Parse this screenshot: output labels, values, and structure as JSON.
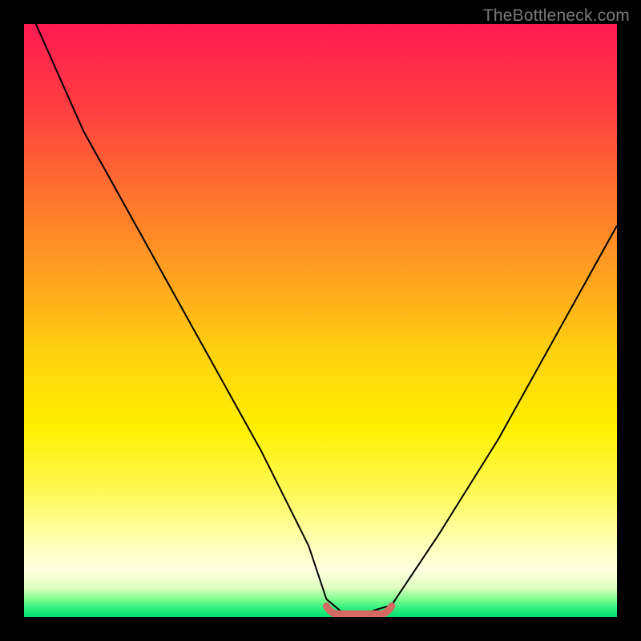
{
  "watermark": "TheBottleneck.com",
  "colors": {
    "frame": "#000000",
    "curve": "#000000",
    "valley_marker": "#d46a63",
    "gradient_stops": [
      {
        "pos": 0.0,
        "hex": "#ff1a52"
      },
      {
        "pos": 0.15,
        "hex": "#ff4040"
      },
      {
        "pos": 0.28,
        "hex": "#ff7030"
      },
      {
        "pos": 0.42,
        "hex": "#ffa020"
      },
      {
        "pos": 0.55,
        "hex": "#ffd010"
      },
      {
        "pos": 0.68,
        "hex": "#fff000"
      },
      {
        "pos": 0.8,
        "hex": "#fffa60"
      },
      {
        "pos": 0.87,
        "hex": "#ffffb0"
      },
      {
        "pos": 0.92,
        "hex": "#ffffe0"
      },
      {
        "pos": 0.95,
        "hex": "#e0ffc0"
      },
      {
        "pos": 0.97,
        "hex": "#80ff90"
      },
      {
        "pos": 0.985,
        "hex": "#30f080"
      },
      {
        "pos": 1.0,
        "hex": "#00e070"
      }
    ]
  },
  "chart_data": {
    "type": "line",
    "title": "",
    "xlabel": "",
    "ylabel": "",
    "xlim": [
      0,
      100
    ],
    "ylim": [
      0,
      100
    ],
    "note": "x/y are approximate percentages of the plot area; y=0 is the bottom (green), y=100 is the top (red). The curve is a V shape with a flat valley region highlighted in salmon.",
    "series": [
      {
        "name": "bottleneck-curve",
        "x": [
          2,
          10,
          20,
          30,
          40,
          48,
          51,
          54,
          57,
          62,
          70,
          80,
          90,
          100
        ],
        "y": [
          100,
          82,
          64,
          46,
          28,
          12,
          3,
          0.5,
          0.5,
          2,
          14,
          30,
          48,
          66
        ]
      }
    ],
    "valley_marker": {
      "name": "optimal-range",
      "x_range": [
        51,
        62
      ],
      "y": 0.5,
      "color": "#d46a63"
    }
  }
}
